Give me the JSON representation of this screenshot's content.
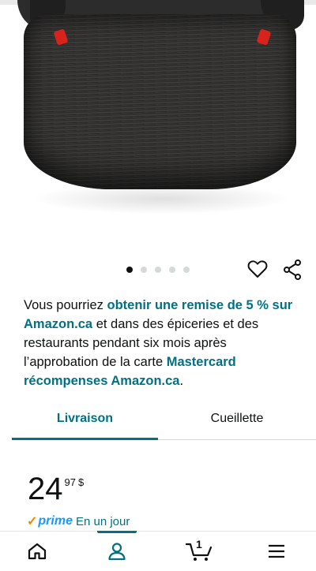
{
  "product": {
    "image_alt": "Siège d'appoint noir",
    "carousel": {
      "total": 5,
      "active_index": 0
    }
  },
  "actions": {
    "wishlist_icon": "heart-icon",
    "share_icon": "share-icon"
  },
  "promo": {
    "p1": "Vous pourriez ",
    "h1": "obtenir une remise de 5 % sur Amazon.ca",
    "p2": " et dans des épiceries et des restaurants pendant six mois après l’approbation de la carte ",
    "h2": "Mastercard récompenses Amazon.ca",
    "p3": "."
  },
  "tabs": [
    {
      "label": "Livraison",
      "active": true
    },
    {
      "label": "Cueillette",
      "active": false
    }
  ],
  "price": {
    "whole": "24",
    "fraction": "97",
    "currency": "$"
  },
  "prime": {
    "check": "✓",
    "brand": "prime",
    "delivery": "En un jour"
  },
  "bottom_nav": {
    "items": [
      "home-icon",
      "account-icon",
      "cart-icon",
      "menu-icon"
    ],
    "cart_count": "1",
    "active": "account"
  },
  "colors": {
    "link": "#007185",
    "prime_blue": "#1a98ff",
    "prime_orange": "#f08804",
    "text": "#0f1111"
  }
}
